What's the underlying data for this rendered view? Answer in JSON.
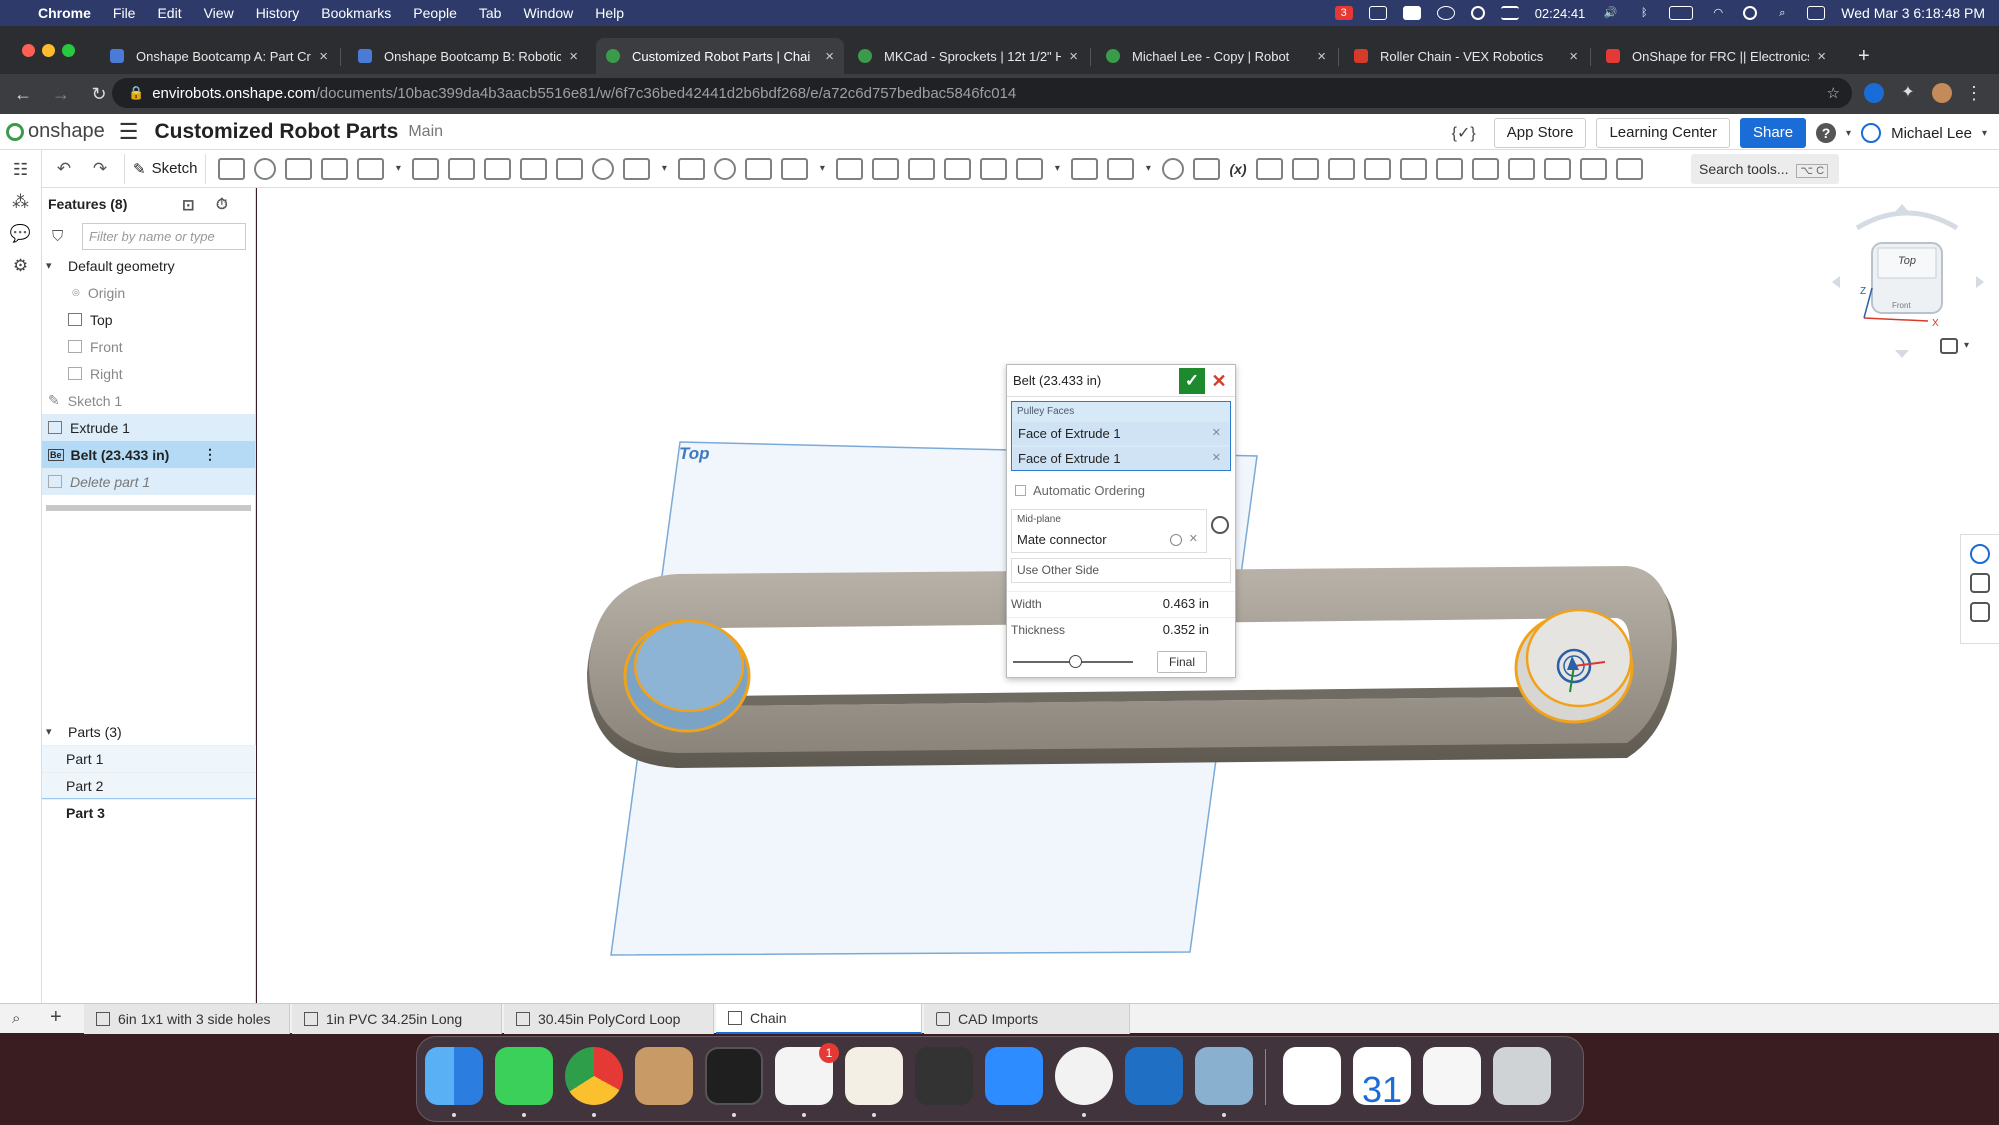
{
  "menubar": {
    "app_name": "Chrome",
    "items": [
      "File",
      "Edit",
      "View",
      "History",
      "Bookmarks",
      "People",
      "Tab",
      "Window",
      "Help"
    ],
    "calendar_badge": "3",
    "timer": "02:24:41",
    "datetime": "Wed Mar 3  6:18:48 PM"
  },
  "tabs": [
    {
      "title": "Onshape Bootcamp A: Part Cre",
      "color": "#4a7bd6"
    },
    {
      "title": "Onshape Bootcamp B: Robotic",
      "color": "#4a7bd6"
    },
    {
      "title": "Customized Robot Parts | Chai",
      "color": "#3a9b4b"
    },
    {
      "title": "MKCad - Sprockets | 12t 1/2\" H",
      "color": "#3a9b4b"
    },
    {
      "title": "Michael Lee - Copy | Robot",
      "color": "#3a9b4b"
    },
    {
      "title": "Roller Chain - VEX Robotics",
      "color": "#d63a2a"
    },
    {
      "title": "OnShape for FRC || Electronics",
      "color": "#e53935"
    }
  ],
  "new_tab_label": "+",
  "address": {
    "host": "envirobots.onshape.com",
    "path": "/documents/10bac399da4b3aacb5516e81/w/6f7c36bed42441d2b6bdf268/e/a72c6d757bedbac5846fc014"
  },
  "header": {
    "logo_text": "onshape",
    "doc_title": "Customized Robot Parts",
    "branch": "Main",
    "app_store": "App Store",
    "learning_center": "Learning Center",
    "share": "Share",
    "help": "?",
    "user": "Michael Lee",
    "brand_color": "#3a9b4b",
    "accent_color": "#1a6cd6"
  },
  "toolbar": {
    "sketch_label": "Sketch",
    "search_label": "Search tools...",
    "search_shortcut": "⌥ C",
    "fx_label": "(x)"
  },
  "features": {
    "header": "Features (8)",
    "filter_placeholder": "Filter by name or type",
    "default_geometry": "Default geometry",
    "origin": "Origin",
    "top": "Top",
    "front": "Front",
    "right": "Right",
    "sketch1": "Sketch 1",
    "extrude1": "Extrude 1",
    "belt": "Belt (23.433 in)",
    "belt_badge": "Be",
    "delete_part": "Delete part 1"
  },
  "parts": {
    "header": "Parts (3)",
    "items": [
      "Part 1",
      "Part 2",
      "Part 3"
    ]
  },
  "viewport": {
    "plane_label": "Top",
    "cube_top": "Top",
    "cube_front": "Front",
    "axis_x": "X",
    "axis_z": "Z"
  },
  "dialog": {
    "title": "Belt (23.433 in)",
    "pulley_faces_label": "Pulley Faces",
    "faces": [
      "Face of Extrude 1",
      "Face of Extrude 1"
    ],
    "automatic_ordering": "Automatic Ordering",
    "midplane_label": "Mid-plane",
    "midplane_value": "Mate connector",
    "use_other_side": "Use Other Side",
    "width_label": "Width",
    "width_value": "0.463 in",
    "thickness_label": "Thickness",
    "thickness_value": "0.352 in",
    "slider_level": 0.52,
    "final_button": "Final"
  },
  "bottom_tabs": [
    {
      "label": "6in 1x1 with 3 side holes",
      "active": false
    },
    {
      "label": "1in PVC 34.25in Long",
      "active": false
    },
    {
      "label": "30.45in PolyCord Loop",
      "active": false
    },
    {
      "label": "Chain",
      "active": true
    },
    {
      "label": "CAD Imports",
      "active": false
    }
  ],
  "dock": {
    "slack_badge": "1",
    "calendar_day": "31",
    "apps": [
      "finder-icon",
      "messages-icon",
      "chrome-icon",
      "contacts-icon",
      "terminal-icon",
      "slack-icon",
      "textedit-icon",
      "calculator-icon",
      "zoom-icon",
      "bear-icon",
      "vscode-icon",
      "preview-icon",
      "gmail-icon",
      "calendar-icon",
      "document-icon",
      "trash-icon"
    ]
  }
}
